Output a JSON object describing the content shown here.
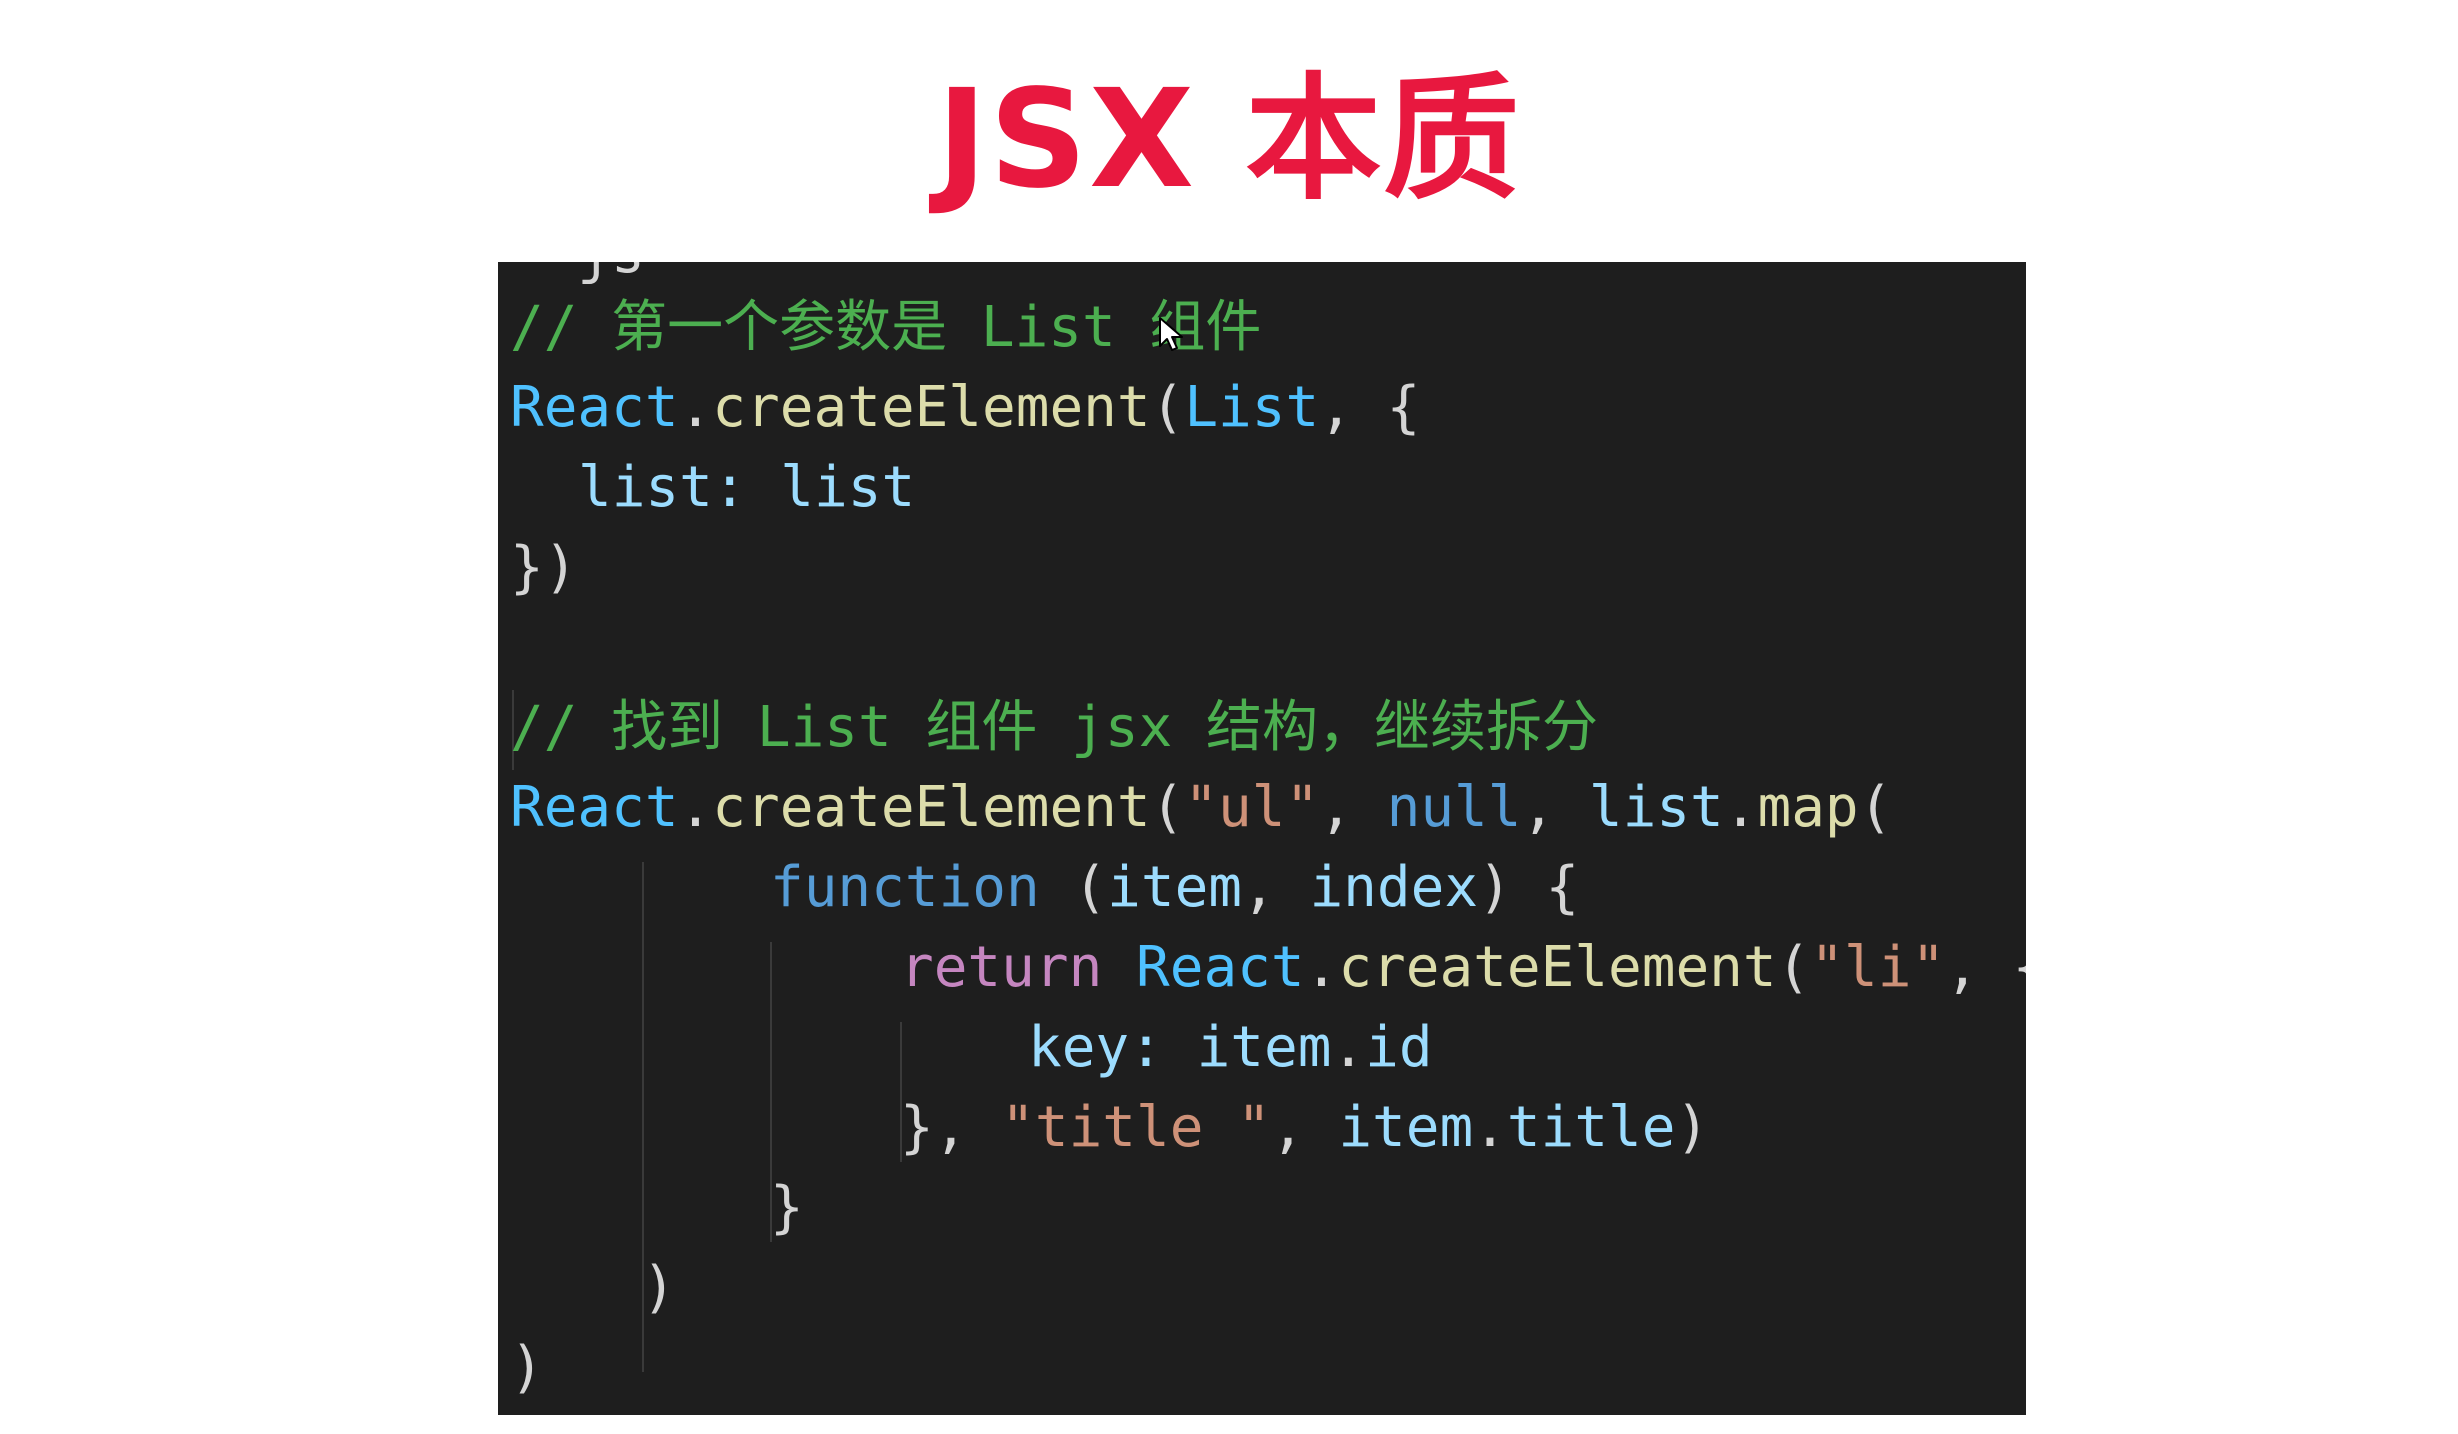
{
  "slide": {
    "title": "JSX 本质"
  },
  "code": {
    "cut_top": "  js",
    "line1_comment": "// 第一个参数是 List 组件",
    "line2": {
      "obj": "React",
      "dot": ".",
      "fn": "createElement",
      "open": "(",
      "arg": "List",
      "rest": ", {"
    },
    "line3": {
      "prop": "list:",
      "value": "list"
    },
    "line4": "})",
    "line6_comment": "// 找到 List 组件 jsx 结构，继续拆分",
    "line7": {
      "obj": "React",
      "dot": ".",
      "fn": "createElement",
      "open": "(",
      "str": "\"ul\"",
      "comma1": ", ",
      "kw": "null",
      "comma2": ", ",
      "var": "list",
      "dot2": ".",
      "fn2": "map",
      "open2": "("
    },
    "line8": {
      "kw": "function",
      "sp": " (",
      "p1": "item",
      "comma": ", ",
      "p2": "index",
      "close": ") {"
    },
    "line9": {
      "kw": "return",
      "sp": " ",
      "obj": "React",
      "dot": ".",
      "fn": "createElement",
      "open": "(",
      "str": "\"li\"",
      "rest": ", {"
    },
    "line10": {
      "prop": "key:",
      "var": "item",
      "dot": ".",
      "field": "id"
    },
    "line11": {
      "close": "}, ",
      "str": "\"title \"",
      "comma": ", ",
      "var": "item",
      "dot": ".",
      "field": "title",
      "paren": ")"
    },
    "line12": "}",
    "line13": ")",
    "line14": ")"
  },
  "colors": {
    "title": "#e8183f",
    "panel_bg": "#1e1e1e",
    "comment": "#4caf50",
    "object": "#4fc1ff",
    "function": "#dcdcaa",
    "variable": "#9cdcfe",
    "keyword": "#569cd6",
    "control": "#c586c0",
    "string": "#ce9178"
  },
  "icons": {
    "cursor": "mouse-pointer-icon"
  }
}
